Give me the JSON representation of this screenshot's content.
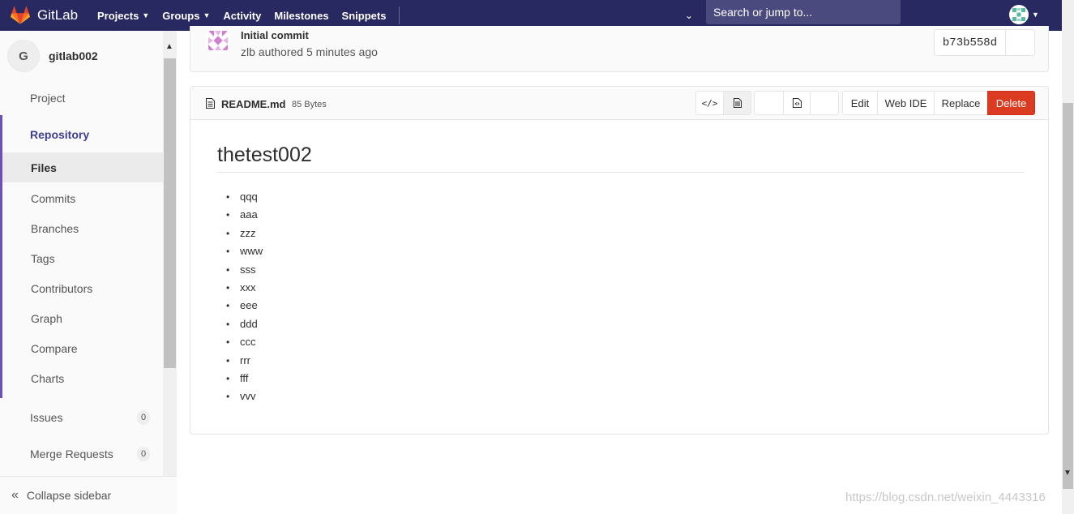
{
  "topnav": {
    "brand": "GitLab",
    "items": [
      {
        "label": "Projects",
        "dropdown": true
      },
      {
        "label": "Groups",
        "dropdown": true
      },
      {
        "label": "Activity",
        "dropdown": false
      },
      {
        "label": "Milestones",
        "dropdown": false
      },
      {
        "label": "Snippets",
        "dropdown": false
      }
    ],
    "search_placeholder": "Search or jump to...",
    "colors": {
      "bar": "#292961",
      "search": "#4a4a7e"
    }
  },
  "sidebar": {
    "project_initial": "G",
    "project_name": "gitlab002",
    "project_label": "Project",
    "repository_label": "Repository",
    "repo_items": [
      "Files",
      "Commits",
      "Branches",
      "Tags",
      "Contributors",
      "Graph",
      "Compare",
      "Charts"
    ],
    "issues_label": "Issues",
    "issues_count": "0",
    "mr_label": "Merge Requests",
    "mr_count": "0",
    "collapse_label": "Collapse sidebar"
  },
  "commit": {
    "title": "Initial commit",
    "meta": "zlb authored 5 minutes ago",
    "sha": "b73b558d"
  },
  "file": {
    "name": "README.md",
    "size": "85 Bytes",
    "buttons": {
      "edit": "Edit",
      "web_ide": "Web IDE",
      "replace": "Replace",
      "delete": "Delete"
    },
    "delete_color": "#db3b21"
  },
  "readme": {
    "heading": "thetest002",
    "items": [
      "qqq",
      "aaa",
      "zzz",
      "www",
      "sss",
      "xxx",
      "eee",
      "ddd",
      "ccc",
      "rrr",
      "fff",
      "vvv"
    ]
  },
  "watermark": "https://blog.csdn.net/weixin_4443316"
}
